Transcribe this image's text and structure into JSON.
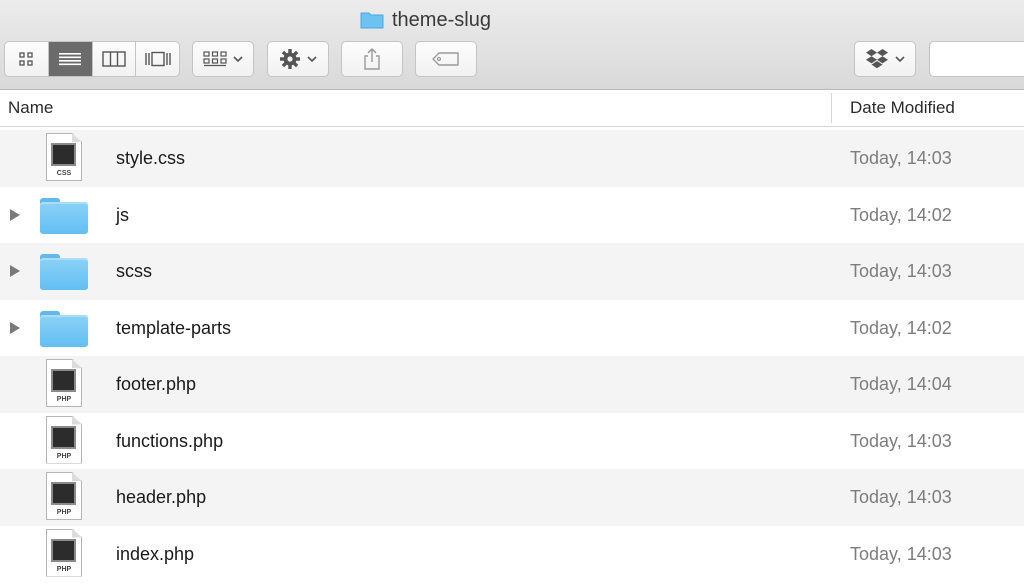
{
  "window": {
    "title": "theme-slug"
  },
  "toolbar": {
    "view_modes": [
      {
        "name": "icon-view",
        "active": false
      },
      {
        "name": "list-view",
        "active": true
      },
      {
        "name": "column-view",
        "active": false
      },
      {
        "name": "cover-flow-view",
        "active": false
      }
    ],
    "icons": {
      "arrange": "arrange-grid-icon",
      "action": "gear-icon",
      "share": "share-icon",
      "tags": "tag-icon",
      "dropbox": "dropbox-icon"
    }
  },
  "columns": {
    "name": "Name",
    "date_modified": "Date Modified"
  },
  "files": [
    {
      "name": "style.css",
      "date": "Today, 14:03",
      "kind": "file",
      "ext": "CSS"
    },
    {
      "name": "js",
      "date": "Today, 14:02",
      "kind": "folder"
    },
    {
      "name": "scss",
      "date": "Today, 14:03",
      "kind": "folder"
    },
    {
      "name": "template-parts",
      "date": "Today, 14:02",
      "kind": "folder"
    },
    {
      "name": "footer.php",
      "date": "Today, 14:04",
      "kind": "file",
      "ext": "PHP"
    },
    {
      "name": "functions.php",
      "date": "Today, 14:03",
      "kind": "file",
      "ext": "PHP"
    },
    {
      "name": "header.php",
      "date": "Today, 14:03",
      "kind": "file",
      "ext": "PHP"
    },
    {
      "name": "index.php",
      "date": "Today, 14:03",
      "kind": "file",
      "ext": "PHP"
    }
  ],
  "colors": {
    "folder": "#62bff1",
    "selected_segment": "#6b6b6b",
    "date_text": "#7d7d7d"
  }
}
